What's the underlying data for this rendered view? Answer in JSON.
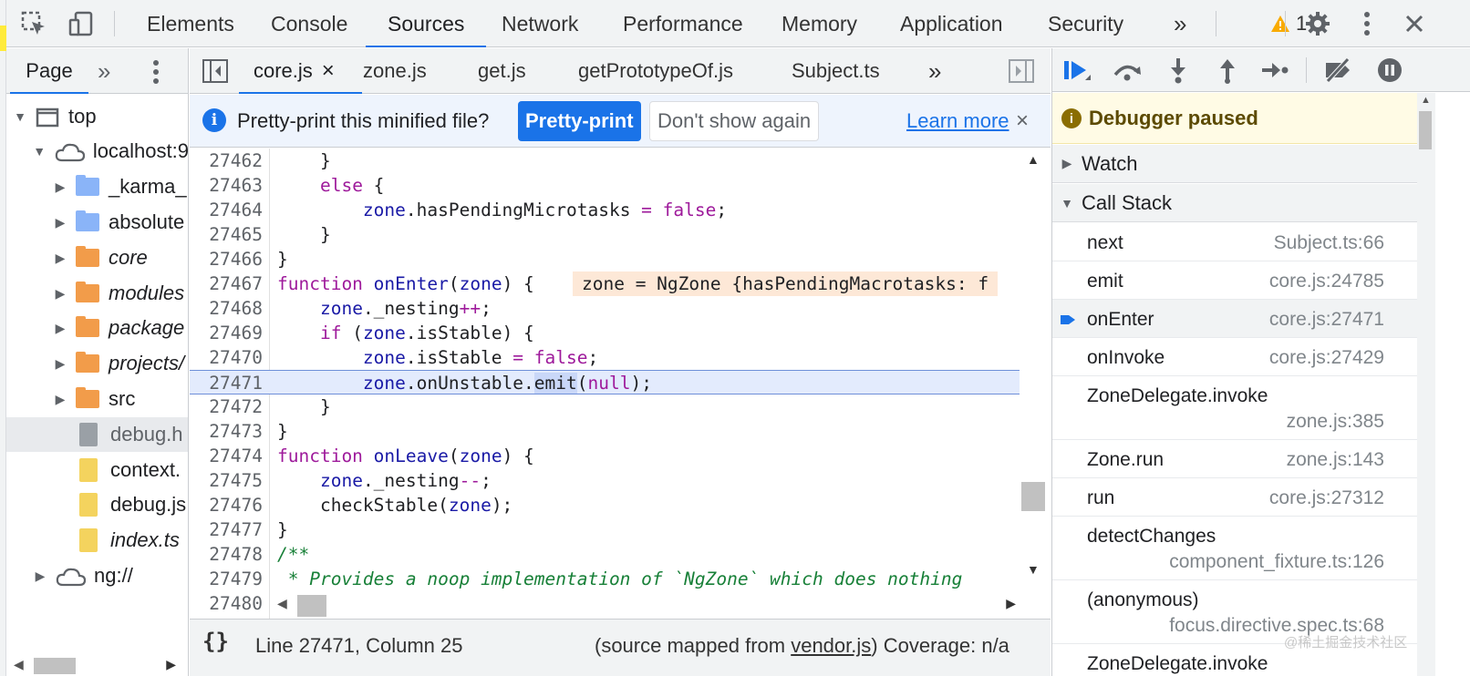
{
  "topbar": {
    "tabs": [
      "Elements",
      "Console",
      "Sources",
      "Network",
      "Performance",
      "Memory",
      "Application",
      "Security"
    ],
    "active_tab": "Sources",
    "more_glyph": "»",
    "warnings_count": "1",
    "icons": [
      "inspect-element-icon",
      "device-toggle-icon",
      "warning-icon",
      "settings-gear-icon",
      "kebab-menu-icon",
      "close-icon"
    ]
  },
  "navigator": {
    "page_tab": "Page",
    "more_glyph": "»",
    "tree": [
      {
        "label": "top",
        "icon": "frame-icon",
        "expanded": true
      },
      {
        "label": "localhost:9",
        "icon": "cloud-icon",
        "expanded": true
      },
      {
        "label": "_karma_",
        "icon": "folder-blue-icon",
        "expanded": false
      },
      {
        "label": "absolute",
        "icon": "folder-blue-icon",
        "expanded": false
      },
      {
        "label": "core",
        "icon": "folder-orange-icon",
        "expanded": false
      },
      {
        "label": "modules",
        "icon": "folder-orange-icon",
        "expanded": false
      },
      {
        "label": "package",
        "icon": "folder-orange-icon",
        "expanded": false
      },
      {
        "label": "projects/",
        "icon": "folder-orange-icon",
        "expanded": false
      },
      {
        "label": "src",
        "icon": "folder-orange-icon",
        "expanded": false
      },
      {
        "label": "debug.h",
        "icon": "file-gray-icon",
        "selected": true
      },
      {
        "label": "context.",
        "icon": "file-yellow-icon"
      },
      {
        "label": "debug.js",
        "icon": "file-yellow-icon"
      },
      {
        "label": "index.ts",
        "icon": "file-yellow-icon"
      },
      {
        "label": "ng://",
        "icon": "cloud-icon",
        "expanded": false
      }
    ]
  },
  "editor": {
    "file_tabs": [
      "core.js",
      "zone.js",
      "get.js",
      "getPrototypeOf.js",
      "Subject.ts"
    ],
    "active_file": "core.js",
    "more_glyph": "»",
    "infobar": {
      "message": "Pretty-print this minified file?",
      "primary_button": "Pretty-print",
      "secondary_button": "Don't show again",
      "link": "Learn more",
      "close_glyph": "×"
    },
    "lines": [
      {
        "n": "27462"
      },
      {
        "n": "27463"
      },
      {
        "n": "27464"
      },
      {
        "n": "27465"
      },
      {
        "n": "27466"
      },
      {
        "n": "27467"
      },
      {
        "n": "27468"
      },
      {
        "n": "27469"
      },
      {
        "n": "27470"
      },
      {
        "n": "27471"
      },
      {
        "n": "27472"
      },
      {
        "n": "27473"
      },
      {
        "n": "27474"
      },
      {
        "n": "27475"
      },
      {
        "n": "27476"
      },
      {
        "n": "27477"
      },
      {
        "n": "27478"
      },
      {
        "n": "27479"
      },
      {
        "n": "27480"
      }
    ],
    "inline_value": "zone = NgZone {hasPendingMacrotasks: f",
    "execution_line": "27471",
    "status": {
      "braces": "{}",
      "position": "Line 27471, Column 25",
      "mapped_prefix": "(source mapped from ",
      "mapped_file": "vendor.js",
      "mapped_suffix": ")",
      "coverage": "Coverage: n/a"
    }
  },
  "debugger": {
    "paused_label": "Debugger paused",
    "watch_label": "Watch",
    "callstack_label": "Call Stack",
    "frames": [
      {
        "name": "next",
        "loc": "Subject.ts:66"
      },
      {
        "name": "emit",
        "loc": "core.js:24785"
      },
      {
        "name": "onEnter",
        "loc": "core.js:27471",
        "current": true
      },
      {
        "name": "onInvoke",
        "loc": "core.js:27429"
      },
      {
        "name": "ZoneDelegate.invoke",
        "loc": "zone.js:385"
      },
      {
        "name": "Zone.run",
        "loc": "zone.js:143"
      },
      {
        "name": "run",
        "loc": "core.js:27312"
      },
      {
        "name": "detectChanges",
        "loc": "component_fixture.ts:126"
      },
      {
        "name": "(anonymous)",
        "loc": "focus.directive.spec.ts:68"
      },
      {
        "name": "ZoneDelegate.invoke",
        "loc": ""
      }
    ]
  },
  "watermark": "@稀土掘金技术社区",
  "colors": {
    "accent": "#1a73e8",
    "keyword": "#9e1a9b",
    "comment": "#188038",
    "paused_bg": "#fffbe5"
  }
}
